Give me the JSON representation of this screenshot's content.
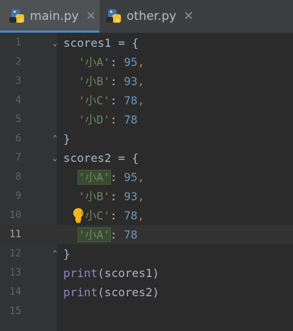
{
  "tabs": [
    {
      "label": "main.py",
      "active": true,
      "icon": "python-file-icon",
      "close": "✕"
    },
    {
      "label": "other.py",
      "active": false,
      "icon": "python-file-icon",
      "close": "✕"
    }
  ],
  "current_line": 11,
  "lines": [
    {
      "n": "1",
      "segs": [
        [
          "",
          "scores1 = {"
        ]
      ]
    },
    {
      "n": "2",
      "segs": [
        [
          "str",
          "'小A'"
        ],
        [
          "",
          ": "
        ],
        [
          "num",
          "95"
        ],
        [
          "kw",
          ","
        ]
      ]
    },
    {
      "n": "3",
      "segs": [
        [
          "str",
          "'小B'"
        ],
        [
          "",
          ": "
        ],
        [
          "num",
          "93"
        ],
        [
          "kw",
          ","
        ]
      ]
    },
    {
      "n": "4",
      "segs": [
        [
          "str",
          "'小C'"
        ],
        [
          "",
          ": "
        ],
        [
          "num",
          "78"
        ],
        [
          "kw",
          ","
        ]
      ]
    },
    {
      "n": "5",
      "segs": [
        [
          "str",
          "'小D'"
        ],
        [
          "",
          ": "
        ],
        [
          "num",
          "78"
        ]
      ]
    },
    {
      "n": "6",
      "segs": [
        [
          "",
          "}"
        ]
      ]
    },
    {
      "n": "7",
      "segs": [
        [
          "",
          "scores2 = {"
        ]
      ]
    },
    {
      "n": "8",
      "segs": [
        [
          "str",
          "'小A'"
        ],
        [
          "",
          ": "
        ],
        [
          "num",
          "95"
        ],
        [
          "kw",
          ","
        ]
      ]
    },
    {
      "n": "9",
      "segs": [
        [
          "str",
          "'小B'"
        ],
        [
          "",
          ": "
        ],
        [
          "num",
          "93"
        ],
        [
          "kw",
          ","
        ]
      ]
    },
    {
      "n": "10",
      "segs": [
        [
          "str",
          "'小C'"
        ],
        [
          "",
          ": "
        ],
        [
          "num",
          "78"
        ],
        [
          "kw",
          ","
        ]
      ]
    },
    {
      "n": "11",
      "segs": [
        [
          "str",
          "'小A'"
        ],
        [
          "",
          ": "
        ],
        [
          "num",
          "78"
        ]
      ]
    },
    {
      "n": "12",
      "segs": [
        [
          "",
          "}"
        ]
      ]
    },
    {
      "n": "13",
      "segs": [
        [
          "fn",
          "print"
        ],
        [
          "",
          "(scores1)"
        ]
      ]
    },
    {
      "n": "14",
      "segs": [
        [
          "fn",
          "print"
        ],
        [
          "",
          "(scores2)"
        ]
      ]
    },
    {
      "n": "15",
      "segs": []
    }
  ],
  "colors": {
    "background": "#2b2b2b",
    "string": "#6a8759",
    "number": "#6897bb",
    "keyword": "#cc7832",
    "builtin": "#8888c6"
  }
}
